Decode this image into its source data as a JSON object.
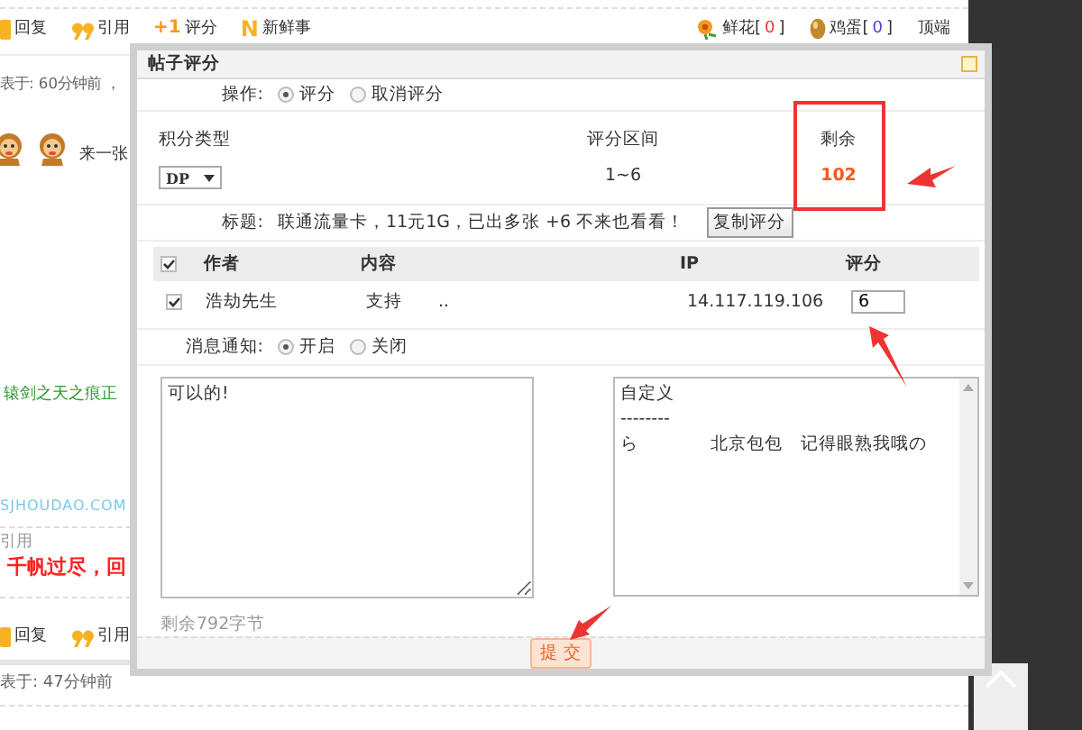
{
  "page": {
    "toolbar_top": {
      "left": [
        {
          "kind": "reply",
          "label": "回复"
        },
        {
          "kind": "quote",
          "label": "引用"
        },
        {
          "kind": "rate",
          "icon": "+1",
          "label": "评分"
        },
        {
          "kind": "news",
          "icon": "N",
          "label": "新鲜事"
        }
      ],
      "right": [
        {
          "kind": "flower",
          "label": "鲜花",
          "bracket_open": "[",
          "count": "0",
          "bracket_close": "]"
        },
        {
          "kind": "egg",
          "label": "鸡蛋",
          "bracket_open": "[",
          "count": "0",
          "bracket_close": "]"
        },
        {
          "kind": "top",
          "label": "顶端"
        }
      ]
    },
    "post_time_1": "表于: 60分钟前 ，",
    "post_text": "来一张",
    "green_link": "辕剑之天之痕正",
    "signature_url": "SJHOUDAO.COM",
    "quote_label": "引用",
    "red_text": "千帆过尽，回",
    "toolbar_bottom": [
      {
        "kind": "reply",
        "label": "回复"
      },
      {
        "kind": "quote",
        "label": "引用"
      }
    ],
    "post_time_2": "表于: 47分钟前"
  },
  "dialog": {
    "title": "帖子评分",
    "operation": {
      "label": "操作:",
      "options": [
        {
          "label": "评分",
          "selected": true
        },
        {
          "label": "取消评分",
          "selected": false
        }
      ]
    },
    "score_type": {
      "label": "积分类型",
      "value": "DP"
    },
    "range": {
      "label": "评分区间",
      "value": "1~6"
    },
    "remaining": {
      "label": "剩余",
      "value": "102"
    },
    "subject": {
      "label": "标题:",
      "value": "联通流量卡，11元1G，已出多张 +6 不来也看看！",
      "button": "复制评分"
    },
    "table": {
      "columns": [
        "作者",
        "内容",
        "IP",
        "评分"
      ],
      "header_checked": true,
      "rows": [
        {
          "checked": true,
          "author": "浩劫先生",
          "content": "支持",
          "extra": "..",
          "ip": "14.117.119.106",
          "score": "6"
        }
      ]
    },
    "notify": {
      "label": "消息通知:",
      "options": [
        {
          "label": "开启",
          "selected": true
        },
        {
          "label": "关闭",
          "selected": false
        }
      ]
    },
    "reason": "可以的!",
    "presets": [
      "自定义",
      "--------",
      "ら　　　　北京包包　记得眼熟我哦の"
    ],
    "bytes_left": "剩余792字节",
    "submit": "提 交"
  }
}
